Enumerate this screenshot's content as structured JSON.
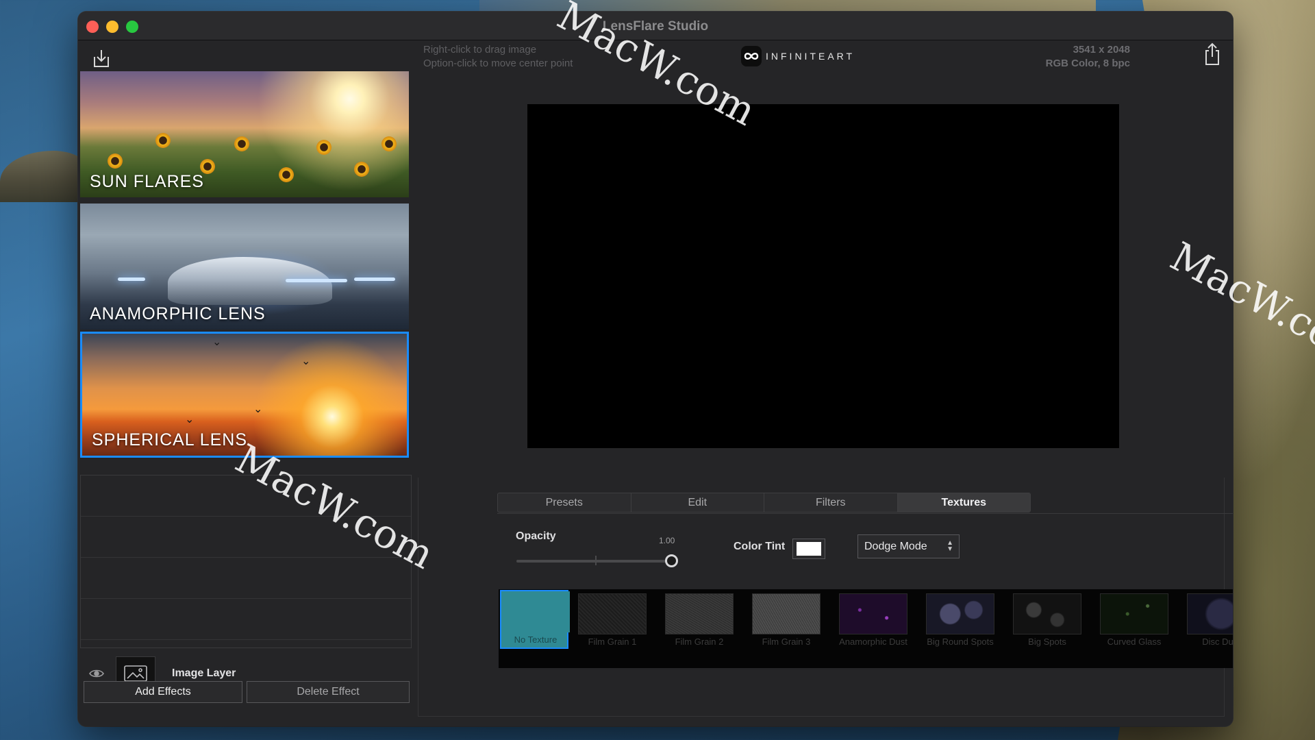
{
  "window": {
    "title": "LensFlare Studio"
  },
  "toolbar": {
    "import_icon": "import-icon",
    "share_icon": "share-icon",
    "hint_line1": "Right-click to drag image",
    "hint_line2": "Option-click to move center point",
    "brand_text": "INFINITEART",
    "image_size": "3541 x 2048",
    "image_mode": "RGB Color, 8 bpc"
  },
  "categories": [
    {
      "label": "SUN FLARES"
    },
    {
      "label": "ANAMORPHIC LENS"
    },
    {
      "label": "SPHERICAL LENS",
      "selected": true
    }
  ],
  "layers": {
    "image_layer_label": "Image Layer",
    "add_effects": "Add Effects",
    "delete_effect": "Delete Effect"
  },
  "tabs": [
    {
      "label": "Presets"
    },
    {
      "label": "Edit"
    },
    {
      "label": "Filters"
    },
    {
      "label": "Textures",
      "active": true
    }
  ],
  "texture_controls": {
    "opacity_label": "Opacity",
    "opacity_value": "1.00",
    "color_tint_label": "Color Tint",
    "color_tint": "#ffffff",
    "blend_mode": "Dodge Mode"
  },
  "textures": [
    {
      "label": "No Texture",
      "selected": true
    },
    {
      "label": "Film Grain 1"
    },
    {
      "label": "Film Grain 2"
    },
    {
      "label": "Film Grain 3"
    },
    {
      "label": "Anamorphic Dust"
    },
    {
      "label": "Big Round Spots"
    },
    {
      "label": "Big Spots"
    },
    {
      "label": "Curved Glass"
    },
    {
      "label": "Disc Dust"
    }
  ],
  "watermark": "MacW.com",
  "colors": {
    "accent": "#1a8cff",
    "window_bg": "#252527",
    "selected_texture": "#2f8a94"
  }
}
